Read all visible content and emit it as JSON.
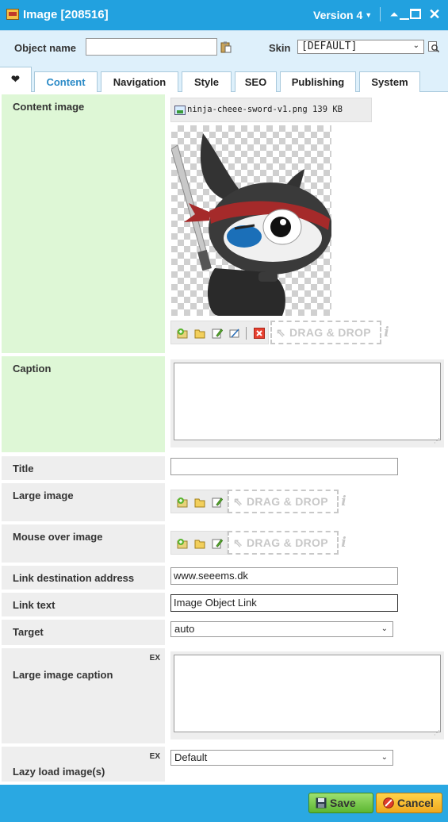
{
  "window": {
    "title": "Image [208516]",
    "version": "Version 4",
    "icons": [
      "image-object-icon",
      "chevron-up-icon",
      "minimize-icon",
      "maximize-icon",
      "close-icon"
    ]
  },
  "object_bar": {
    "name_label": "Object name",
    "name_value": "",
    "skin_label": "Skin",
    "skin_value": "[DEFAULT]"
  },
  "tabs": {
    "favorite": "❤",
    "items": [
      {
        "label": "Content",
        "active": true
      },
      {
        "label": "Navigation",
        "active": false
      },
      {
        "label": "Style",
        "active": false
      },
      {
        "label": "SEO",
        "active": false
      },
      {
        "label": "Publishing",
        "active": false
      },
      {
        "label": "System",
        "active": false
      }
    ]
  },
  "fields": {
    "content_image": {
      "label": "Content image",
      "file_name": "ninja-cheee-sword-v1.png",
      "file_size": "139 KB",
      "drag_drop": "DRAG & DROP",
      "info": "i"
    },
    "caption": {
      "label": "Caption",
      "value": ""
    },
    "title": {
      "label": "Title",
      "value": ""
    },
    "large_image": {
      "label": "Large image",
      "drag_drop": "DRAG & DROP",
      "info": "i"
    },
    "mouse_over_image": {
      "label": "Mouse over image",
      "drag_drop": "DRAG & DROP",
      "info": "i"
    },
    "link_destination": {
      "label": "Link destination address",
      "value": "www.seeems.dk"
    },
    "link_text": {
      "label": "Link text",
      "value": "Image Object Link"
    },
    "target": {
      "label": "Target",
      "value": "auto"
    },
    "large_image_caption": {
      "label": "Large image caption",
      "badge": "EX",
      "value": ""
    },
    "lazy_load": {
      "label": "Lazy load image(s)",
      "badge": "EX",
      "value": "Default"
    }
  },
  "footer": {
    "save_label": "Save",
    "cancel_label": "Cancel"
  },
  "colors": {
    "titlebar": "#22a1df",
    "active_tab_text": "#2c8bc7",
    "required_label_bg": "#def7d6",
    "label_bg": "#eeeeee",
    "save_green": "#5cb631",
    "cancel_orange": "#f0a81d"
  }
}
